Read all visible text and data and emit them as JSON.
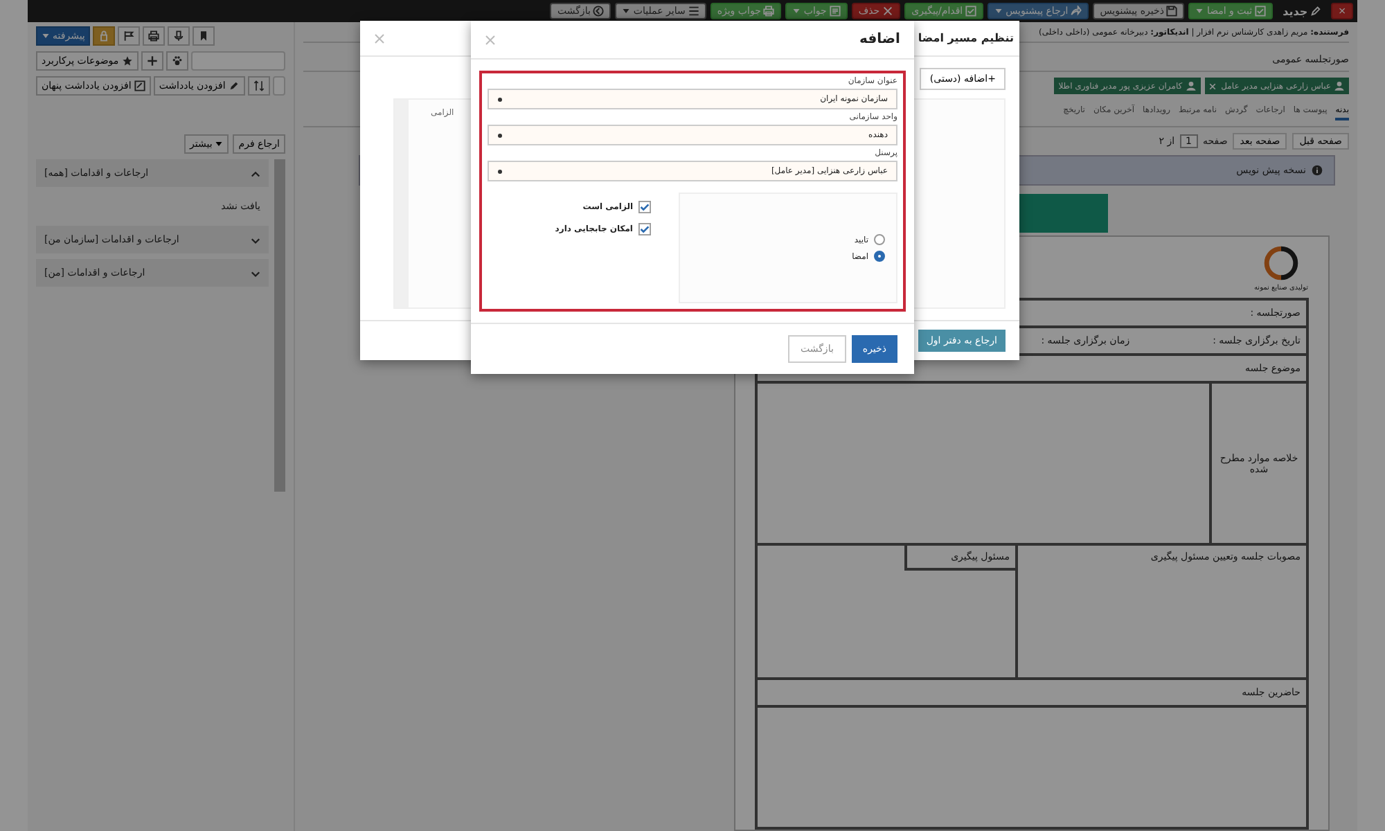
{
  "top_bar": {
    "buttons": [
      {
        "label": "×",
        "kind": "danger",
        "caret": false
      },
      {
        "label": "جدید",
        "kind": "title",
        "caret": false
      },
      {
        "label": "ثبت و امضا",
        "kind": "success",
        "caret": true
      },
      {
        "label": "ذخیره پیشنویس",
        "kind": "default",
        "caret": false
      },
      {
        "label": "ارجاع پیشنویس",
        "kind": "info",
        "caret": true
      },
      {
        "label": "اقدام/پیگیری",
        "kind": "success",
        "caret": false
      },
      {
        "label": "حذف",
        "kind": "danger",
        "caret": false
      },
      {
        "label": "جواب",
        "kind": "success",
        "caret": true
      },
      {
        "label": "جواب ویژه",
        "kind": "success",
        "caret": false
      },
      {
        "label": "سایر عملیات",
        "kind": "default",
        "caret": true
      },
      {
        "label": "بازگشت",
        "kind": "default",
        "caret": false
      }
    ]
  },
  "header": {
    "breadcrumb": "**فرستنده:** مریم زاهدی کارشناس نرم افزار | **اندیکاتور:** دبیرخانه عمومی (داخلی داخلی)",
    "subject": "صورتجلسه عمومی",
    "recipients": [
      {
        "label": "عباس زارعی هنزایی مدیر عامل",
        "removable": true
      },
      {
        "label": "کامران عزیزی پور مدیر فناوری اطلا",
        "removable": false
      }
    ]
  },
  "tabs": [
    {
      "label": "بدنه",
      "selected": true
    },
    {
      "label": "پیوست ها",
      "selected": false
    },
    {
      "label": "ارجاعات",
      "selected": false
    },
    {
      "label": "گردش",
      "selected": false
    },
    {
      "label": "نامه مرتبط",
      "selected": false
    },
    {
      "label": "رویدادها",
      "selected": false
    },
    {
      "label": "آخرین مکان",
      "selected": false
    },
    {
      "label": "تاریخچ",
      "selected": false
    }
  ],
  "pager": {
    "previous": "صفحه قبل",
    "next": "صفحه بعد",
    "page_label": "صفحه",
    "page": "1",
    "of": "از ۲"
  },
  "notice": "نسخه پیش نویس",
  "document": {
    "logo_caption": "تولیدی صنایع نمونه",
    "rows": [
      {
        "kind": "title",
        "label": "صورتجلسه :"
      },
      {
        "kind": "pair",
        "label": "تاریخ برگزاری جلسه :",
        "label_2": "زمان برگزاری جلسه :"
      },
      {
        "kind": "title",
        "label": "موضوع جلسه"
      },
      {
        "kind": "side",
        "label": "خلاصه موارد مطرح شده"
      },
      {
        "kind": "split",
        "label": "مصوبات جلسه وتعیین مسئول پیگیری",
        "label_2": "مسئول پیگیری"
      },
      {
        "kind": "title",
        "label": "حاضرین جلسه"
      }
    ]
  },
  "side_panel": {
    "advanced": "پیشرفته",
    "favorites": "موضوعات پرکاربرد",
    "add_note": "افزودن یادداشت",
    "add_hidden_note": "افزودن یادداشت پنهان",
    "more": "بیشتر",
    "form_referral": "ارجاع فرم",
    "sections": [
      {
        "label": "ارجاعات و اقدامات [همه]",
        "expanded": true,
        "empty_text": "یافت نشد"
      },
      {
        "label": "ارجاعات و اقدامات [سازمان من]",
        "expanded": false
      },
      {
        "label": "ارجاعات و اقدامات [من]",
        "expanded": false
      }
    ]
  },
  "signature_dialog": {
    "title": "تنظیم مسیر امضا",
    "add_button": "+اضافه (دستی)",
    "column": "الزامی",
    "footer_button": "ارجاع به دفتر اول"
  },
  "add_dialog": {
    "title": "اضافه",
    "fields": [
      {
        "label": "عنوان سازمان",
        "value": "سازمان نمونه ایران"
      },
      {
        "label": "واحد سازمانی",
        "value": "دهنده"
      },
      {
        "label": "پرسنل",
        "value": "عباس زارعی هنزایی [مدیر عامل]"
      }
    ],
    "types": [
      {
        "label": "تایید",
        "selected": false
      },
      {
        "label": "امضا",
        "selected": true
      }
    ],
    "options": [
      {
        "label": "الزامی است",
        "checked": true
      },
      {
        "label": "امکان جابجایی دارد",
        "checked": true
      }
    ],
    "save": "ذخیره",
    "back": "بازگشت"
  }
}
